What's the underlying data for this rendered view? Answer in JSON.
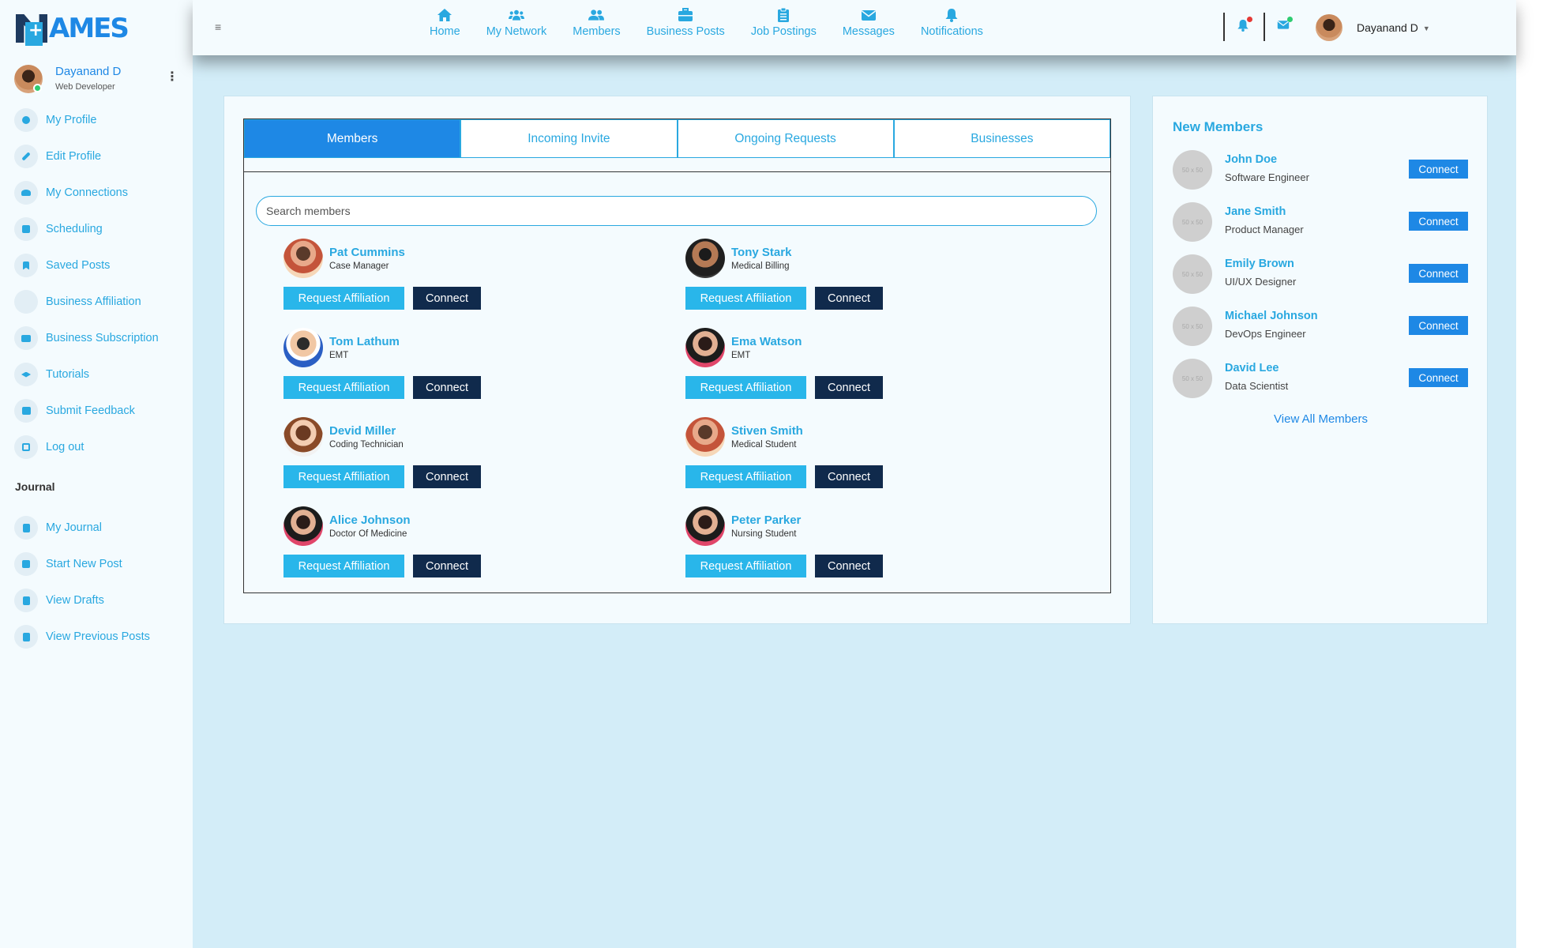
{
  "brand": {
    "logo_text": "AMES"
  },
  "sidebar": {
    "user": {
      "name": "Dayanand D",
      "role": "Web Developer"
    },
    "items": [
      {
        "label": "My Profile",
        "icon": "profile-icon"
      },
      {
        "label": "Edit Profile",
        "icon": "pencil-icon"
      },
      {
        "label": "My Connections",
        "icon": "connections-icon"
      },
      {
        "label": "Scheduling",
        "icon": "calendar-icon"
      },
      {
        "label": "Saved Posts",
        "icon": "bookmark-icon"
      },
      {
        "label": "Business Affiliation",
        "icon": "business-icon"
      },
      {
        "label": "Business Subscription",
        "icon": "card-icon"
      },
      {
        "label": "Tutorials",
        "icon": "graduation-icon"
      },
      {
        "label": "Submit Feedback",
        "icon": "feedback-icon"
      },
      {
        "label": "Log out",
        "icon": "logout-icon"
      }
    ],
    "journal_heading": "Journal",
    "journal_items": [
      {
        "label": "My Journal",
        "icon": "journal-icon"
      },
      {
        "label": "Start New Post",
        "icon": "new-post-icon"
      },
      {
        "label": "View Drafts",
        "icon": "drafts-icon"
      },
      {
        "label": "View Previous Posts",
        "icon": "previous-posts-icon"
      }
    ]
  },
  "topbar": {
    "nav": [
      {
        "label": "Home",
        "icon": "home-icon"
      },
      {
        "label": "My Network",
        "icon": "network-icon"
      },
      {
        "label": "Members",
        "icon": "members-icon"
      },
      {
        "label": "Business Posts",
        "icon": "briefcase-icon"
      },
      {
        "label": "Job Postings",
        "icon": "clipboard-icon"
      },
      {
        "label": "Messages",
        "icon": "envelope-icon"
      },
      {
        "label": "Notifications",
        "icon": "bell-icon"
      }
    ],
    "user_name": "Dayanand D"
  },
  "members_panel": {
    "tabs": [
      "Members",
      "Incoming Invite",
      "Ongoing Requests",
      "Businesses"
    ],
    "active_tab": "Members",
    "search_placeholder": "Search members",
    "affiliation_label": "Request Affiliation",
    "connect_label": "Connect",
    "members": [
      {
        "name": "Pat Cummins",
        "role": "Case Manager"
      },
      {
        "name": "Tony Stark",
        "role": "Medical Billing"
      },
      {
        "name": "Tom Lathum",
        "role": "EMT"
      },
      {
        "name": "Ema Watson",
        "role": "EMT"
      },
      {
        "name": "Devid Miller",
        "role": "Coding Technician"
      },
      {
        "name": "Stiven Smith",
        "role": "Medical Student"
      },
      {
        "name": "Alice Johnson",
        "role": "Doctor Of Medicine"
      },
      {
        "name": "Peter Parker",
        "role": "Nursing Student"
      }
    ]
  },
  "new_members": {
    "title": "New Members",
    "placeholder_text": "50 x 50",
    "connect_label": "Connect",
    "items": [
      {
        "name": "John Doe",
        "role": "Software Engineer"
      },
      {
        "name": "Jane Smith",
        "role": "Product Manager"
      },
      {
        "name": "Emily Brown",
        "role": "UI/UX Designer"
      },
      {
        "name": "Michael Johnson",
        "role": "DevOps Engineer"
      },
      {
        "name": "David Lee",
        "role": "Data Scientist"
      }
    ],
    "view_all": "View All Members"
  },
  "colors": {
    "accent": "#29a8e0",
    "primary": "#1e88e5",
    "dark_button": "#102a4c",
    "background": "#d3edf8"
  }
}
